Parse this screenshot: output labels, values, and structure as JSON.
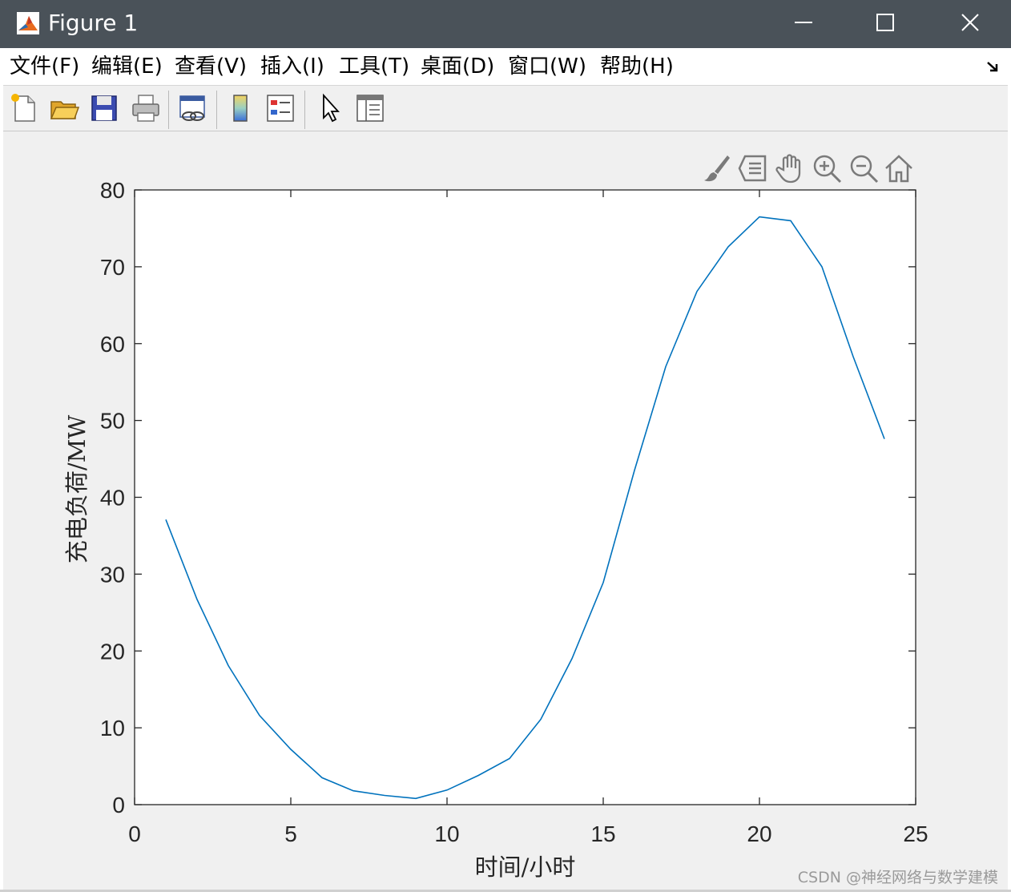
{
  "window": {
    "title": "Figure 1"
  },
  "menu": [
    "文件(F)",
    "编辑(E)",
    "查看(V)",
    "插入(I)",
    "工具(T)",
    "桌面(D)",
    "窗口(W)",
    "帮助(H)"
  ],
  "toolbar": [
    "new-figure-icon",
    "open-file-icon",
    "save-icon",
    "print-icon",
    "link-plot-icon",
    "colorbar-icon",
    "legend-icon",
    "pointer-icon",
    "property-inspector-icon"
  ],
  "axes_toolbar": [
    "brush-icon",
    "data-tips-icon",
    "pan-icon",
    "zoom-in-icon",
    "zoom-out-icon",
    "home-icon"
  ],
  "colors": {
    "line": "#0072BD",
    "titlebar": "#4a5259"
  },
  "chart_data": {
    "type": "line",
    "title": "",
    "xlabel": "时间/小时",
    "ylabel": "充电负荷/MW",
    "xlim": [
      0,
      25
    ],
    "ylim": [
      0,
      80
    ],
    "xticks": [
      0,
      5,
      10,
      15,
      20,
      25
    ],
    "yticks": [
      0,
      10,
      20,
      30,
      40,
      50,
      60,
      70,
      80
    ],
    "x": [
      1,
      2,
      3,
      4,
      5,
      6,
      7,
      8,
      9,
      10,
      11,
      12,
      13,
      14,
      15,
      16,
      17,
      18,
      19,
      20,
      21,
      22,
      23,
      24
    ],
    "series": [
      {
        "values": [
          37.1,
          26.7,
          18.1,
          11.6,
          7.2,
          3.5,
          1.8,
          1.2,
          0.8,
          1.9,
          3.8,
          6.0,
          11.1,
          19.0,
          28.9,
          43.5,
          57.0,
          66.8,
          72.6,
          76.5,
          76.0,
          70.0,
          58.3,
          47.6
        ]
      }
    ],
    "grid": false,
    "box": true
  },
  "watermark": "CSDN @神经网络与数学建模"
}
